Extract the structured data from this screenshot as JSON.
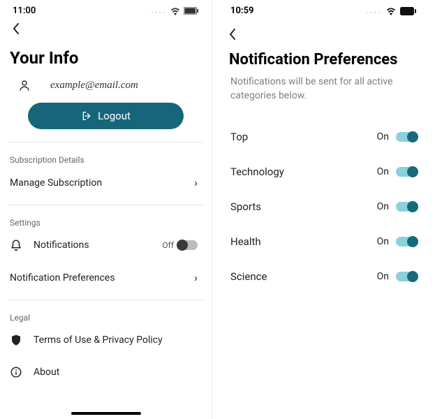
{
  "left": {
    "time": "11:00",
    "title": "Your Info",
    "email": "example@email.com",
    "logout": "Logout",
    "subscription_details_label": "Subscription Details",
    "manage_subscription": "Manage Subscription",
    "settings_label": "Settings",
    "notifications": "Notifications",
    "notifications_state": "Off",
    "notification_preferences": "Notification Preferences",
    "legal_label": "Legal",
    "terms": "Terms of Use & Privacy Policy",
    "about": "About"
  },
  "right": {
    "time": "10:59",
    "title": "Notification Preferences",
    "subtitle": "Notifications will be sent for all active categories below.",
    "items": [
      {
        "label": "Top",
        "state": "On"
      },
      {
        "label": "Technology",
        "state": "On"
      },
      {
        "label": "Sports",
        "state": "On"
      },
      {
        "label": "Health",
        "state": "On"
      },
      {
        "label": "Science",
        "state": "On"
      }
    ]
  }
}
